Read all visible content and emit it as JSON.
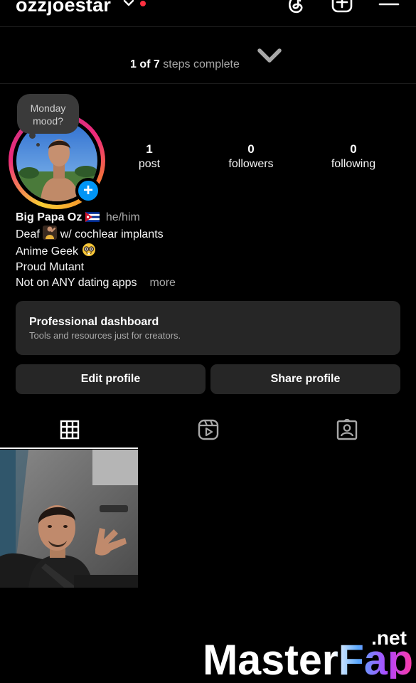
{
  "header": {
    "username": "ozzjoestar",
    "icons": [
      "threads-icon",
      "create-icon",
      "menu-icon"
    ]
  },
  "steps": {
    "completed": "1",
    "of_label": "of",
    "total": "7",
    "suffix": "steps complete"
  },
  "note": {
    "line1": "Monday",
    "line2": "mood?"
  },
  "stats": [
    {
      "value": "1",
      "label": "post"
    },
    {
      "value": "0",
      "label": "followers"
    },
    {
      "value": "0",
      "label": "following"
    }
  ],
  "bio": {
    "name": "Big Papa Oz",
    "pronouns": "he/him",
    "line1_a": "Deaf",
    "line1_b": "w/ cochlear implants",
    "line2": "Anime Geek",
    "line3": "Proud Mutant",
    "line4": "Not on ANY dating apps",
    "more": "more"
  },
  "dashboard": {
    "title": "Professional dashboard",
    "subtitle": "Tools and resources just for creators."
  },
  "buttons": {
    "edit": "Edit profile",
    "share": "Share profile"
  },
  "tabs": [
    "grid-icon",
    "reels-icon",
    "tagged-icon"
  ],
  "watermark": {
    "main": "MasterFap",
    "suffix": ".net"
  },
  "colors": {
    "accent_blue": "#0095f6",
    "notification_red": "#ff3040",
    "surface": "#262626"
  }
}
